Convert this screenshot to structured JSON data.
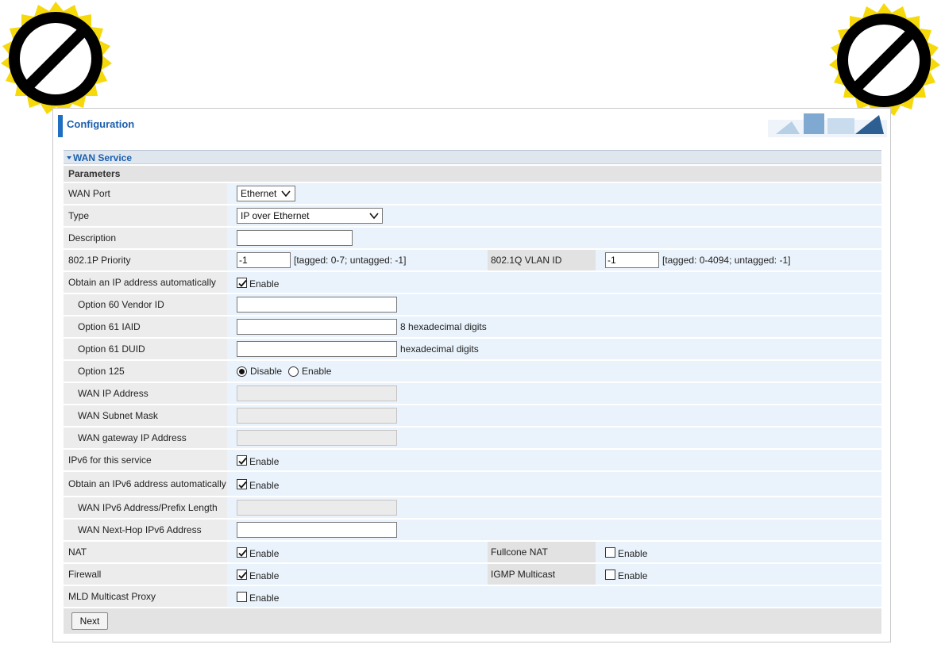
{
  "header": {
    "title": "Configuration"
  },
  "section": {
    "title": "WAN Service",
    "params_label": "Parameters"
  },
  "fields": {
    "wan_port": {
      "label": "WAN Port",
      "value": "Ethernet"
    },
    "type": {
      "label": "Type",
      "value": "IP over Ethernet"
    },
    "description": {
      "label": "Description",
      "value": ""
    },
    "priority": {
      "label": "802.1P Priority",
      "value": "-1",
      "hint": "[tagged: 0-7; untagged: -1]"
    },
    "vlan": {
      "label": "802.1Q VLAN ID",
      "value": "-1",
      "hint": "[tagged: 0-4094; untagged: -1]"
    },
    "obtain_ip": {
      "label": "Obtain an IP address automatically",
      "checked": true,
      "option_label": "Enable"
    },
    "opt60": {
      "label": "Option 60 Vendor ID",
      "value": ""
    },
    "opt61_iaid": {
      "label": "Option 61 IAID",
      "value": "",
      "hint": "8 hexadecimal digits"
    },
    "opt61_duid": {
      "label": "Option 61 DUID",
      "value": "",
      "hint": "hexadecimal digits"
    },
    "opt125": {
      "label": "Option 125",
      "selected": "Disable",
      "options": [
        "Disable",
        "Enable"
      ]
    },
    "wan_ip": {
      "label": "WAN IP Address",
      "value": ""
    },
    "wan_mask": {
      "label": "WAN Subnet Mask",
      "value": ""
    },
    "wan_gw": {
      "label": "WAN gateway IP Address",
      "value": ""
    },
    "ipv6": {
      "label": "IPv6 for this service",
      "checked": true,
      "option_label": "Enable"
    },
    "obtain_ipv6": {
      "label": "Obtain an IPv6 address automatically",
      "checked": true,
      "option_label": "Enable"
    },
    "ipv6_addr": {
      "label": "WAN IPv6 Address/Prefix Length",
      "value": ""
    },
    "ipv6_nexthop": {
      "label": "WAN Next-Hop IPv6 Address",
      "value": ""
    },
    "nat": {
      "label": "NAT",
      "checked": true,
      "option_label": "Enable"
    },
    "fullcone": {
      "label": "Fullcone NAT",
      "checked": false,
      "option_label": "Enable"
    },
    "firewall": {
      "label": "Firewall",
      "checked": true,
      "option_label": "Enable"
    },
    "igmp": {
      "label": "IGMP Multicast",
      "checked": false,
      "option_label": "Enable"
    },
    "mld": {
      "label": "MLD Multicast Proxy",
      "checked": false,
      "option_label": "Enable"
    }
  },
  "buttons": {
    "next": "Next"
  },
  "colors": {
    "accent": "#1b5fae",
    "row_bg": "#eaf3fc",
    "label_bg": "#ececec",
    "badge_yellow": "#f5d90a"
  }
}
